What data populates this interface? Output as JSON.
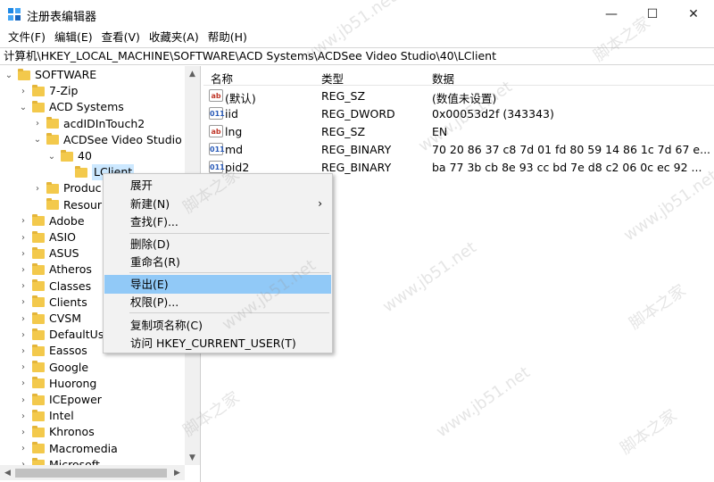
{
  "window": {
    "title": "注册表编辑器",
    "minimize_glyph": "—",
    "maximize_glyph": "☐",
    "close_glyph": "✕"
  },
  "menu": [
    "文件(F)",
    "编辑(E)",
    "查看(V)",
    "收藏夹(A)",
    "帮助(H)"
  ],
  "address": "计算机\\HKEY_LOCAL_MACHINE\\SOFTWARE\\ACD Systems\\ACDSee Video Studio\\40\\LClient",
  "tree": [
    {
      "label": "SOFTWARE",
      "chev": "⌄",
      "indent": 0
    },
    {
      "label": "7-Zip",
      "chev": "›",
      "indent": 1
    },
    {
      "label": "ACD Systems",
      "chev": "⌄",
      "indent": 1
    },
    {
      "label": "acdIDInTouch2",
      "chev": "›",
      "indent": 2
    },
    {
      "label": "ACDSee Video Studio",
      "chev": "⌄",
      "indent": 2
    },
    {
      "label": "40",
      "chev": "⌄",
      "indent": 3
    },
    {
      "label": "LClient",
      "chev": "",
      "indent": 4,
      "selected": true
    },
    {
      "label": "Produc",
      "chev": "›",
      "indent": 2
    },
    {
      "label": "Resour",
      "chev": "",
      "indent": 2
    },
    {
      "label": "Adobe",
      "chev": "›",
      "indent": 1
    },
    {
      "label": "ASIO",
      "chev": "›",
      "indent": 1
    },
    {
      "label": "ASUS",
      "chev": "›",
      "indent": 1
    },
    {
      "label": "Atheros",
      "chev": "›",
      "indent": 1
    },
    {
      "label": "Classes",
      "chev": "›",
      "indent": 1
    },
    {
      "label": "Clients",
      "chev": "›",
      "indent": 1
    },
    {
      "label": "CVSM",
      "chev": "›",
      "indent": 1
    },
    {
      "label": "DefaultUs",
      "chev": "›",
      "indent": 1
    },
    {
      "label": "Eassos",
      "chev": "›",
      "indent": 1
    },
    {
      "label": "Google",
      "chev": "›",
      "indent": 1
    },
    {
      "label": "Huorong",
      "chev": "›",
      "indent": 1
    },
    {
      "label": "ICEpower",
      "chev": "›",
      "indent": 1
    },
    {
      "label": "Intel",
      "chev": "›",
      "indent": 1
    },
    {
      "label": "Khronos",
      "chev": "›",
      "indent": 1
    },
    {
      "label": "Macromedia",
      "chev": "›",
      "indent": 1
    },
    {
      "label": "Microsoft",
      "chev": "›",
      "indent": 1
    }
  ],
  "columns": {
    "name": "名称",
    "type": "类型",
    "data": "数据"
  },
  "values": [
    {
      "icon": "ab",
      "name": "(默认)",
      "type": "REG_SZ",
      "data": "(数值未设置)"
    },
    {
      "icon": "011",
      "name": "iid",
      "type": "REG_DWORD",
      "data": "0x00053d2f (343343)"
    },
    {
      "icon": "ab",
      "name": "lng",
      "type": "REG_SZ",
      "data": "EN"
    },
    {
      "icon": "011",
      "name": "md",
      "type": "REG_BINARY",
      "data": "70 20 86 37 c8 7d 01 fd 80 59 14 86 1c 7d 67 e..."
    },
    {
      "icon": "011",
      "name": "pid2",
      "type": "REG_BINARY",
      "data": "ba 77 3b cb 8e 93 cc bd 7e d8 c2 06 0c ec 92 ..."
    }
  ],
  "context_menu": {
    "expand": "展开",
    "new": "新建(N)",
    "find": "查找(F)...",
    "delete": "删除(D)",
    "rename": "重命名(R)",
    "export": "导出(E)",
    "permissions": "权限(P)...",
    "copy_key_name": "复制项名称(C)",
    "visit_hkcu": "访问 HKEY_CURRENT_USER(T)"
  },
  "watermark": {
    "site": "www.jb51.net",
    "brand": "脚本之家"
  }
}
